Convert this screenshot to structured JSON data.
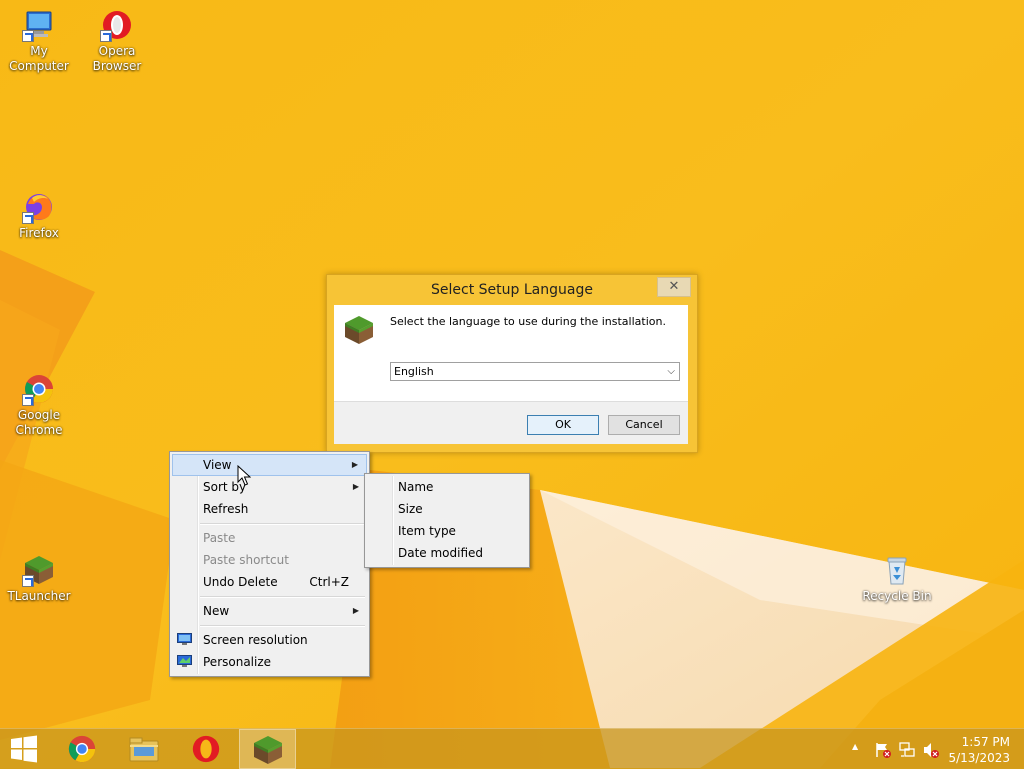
{
  "desktop": {
    "icons": [
      {
        "label_1": "My Computer",
        "label_2": ""
      },
      {
        "label_1": "Opera",
        "label_2": "Browser"
      },
      {
        "label_1": "Firefox",
        "label_2": ""
      },
      {
        "label_1": "Google",
        "label_2": "Chrome"
      },
      {
        "label_1": "TLauncher",
        "label_2": ""
      },
      {
        "label_1": "Recycle Bin",
        "label_2": ""
      }
    ]
  },
  "dialog": {
    "title": "Select Setup Language",
    "close_glyph": "✕",
    "prompt": "Select the language to use during the installation.",
    "language_selected": "English",
    "ok_label": "OK",
    "cancel_label": "Cancel"
  },
  "context_menu": {
    "items": [
      {
        "label": "View",
        "submenu": true
      },
      {
        "label": "Sort by",
        "submenu": true
      },
      {
        "label": "Refresh"
      },
      {
        "label": "Paste",
        "disabled": true
      },
      {
        "label": "Paste shortcut",
        "disabled": true
      },
      {
        "label": "Undo Delete",
        "accel": "Ctrl+Z"
      },
      {
        "label": "New",
        "submenu": true
      },
      {
        "label": "Screen resolution"
      },
      {
        "label": "Personalize"
      }
    ],
    "submenu_view": [
      "Name",
      "Size",
      "Item type",
      "Date modified"
    ]
  },
  "taskbar": {
    "clock_time": "1:57 PM",
    "clock_date": "5/13/2023",
    "tray_chevron": "▲"
  },
  "colors": {
    "wallpaper": "#f7b814",
    "menu_highlight": "#d5e5f8"
  }
}
